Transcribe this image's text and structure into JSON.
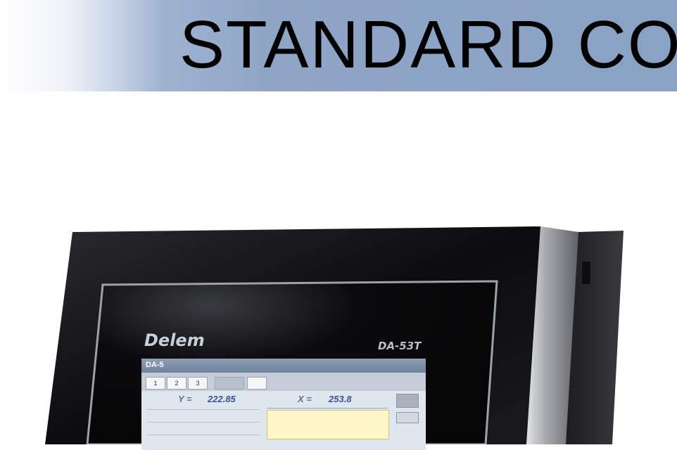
{
  "slide": {
    "title": "STANDARD CO"
  },
  "device": {
    "brand": "Delem",
    "model": "DA-53T",
    "screen": {
      "header": "DA-5",
      "tabs": [
        "1",
        "2",
        "3",
        "",
        ""
      ],
      "readout_y_label": "Y =",
      "readout_y_value": "222.85",
      "readout_x_label": "X =",
      "readout_x_value": "253.8"
    }
  }
}
